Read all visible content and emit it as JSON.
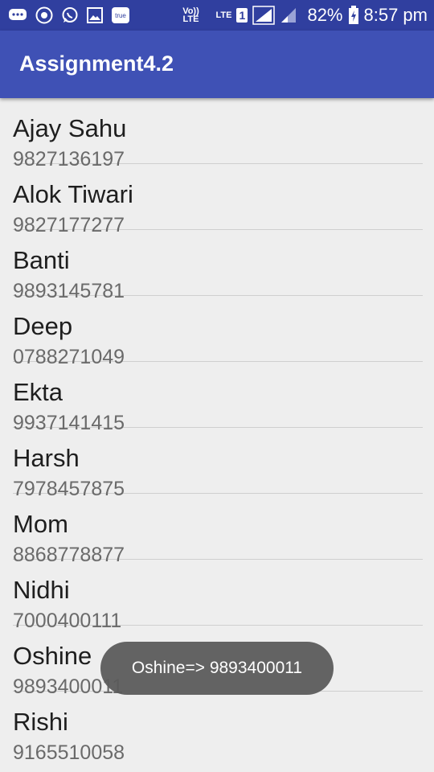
{
  "status_bar": {
    "battery_percent": "82%",
    "time": "8:57 pm",
    "volte_label": "Vo)) LTE",
    "lte_label": "LTE",
    "sim_number": "1",
    "icons": [
      "messages-icon",
      "browser-icon",
      "whatsapp-icon",
      "gallery-icon",
      "truecaller-icon",
      "signal-icon",
      "battery-icon"
    ],
    "truecaller_label": "true"
  },
  "app_bar": {
    "title": "Assignment4.2"
  },
  "contacts": [
    {
      "name": "Ajay Sahu",
      "phone": "9827136197"
    },
    {
      "name": "Alok Tiwari",
      "phone": "9827177277"
    },
    {
      "name": "Banti",
      "phone": "9893145781"
    },
    {
      "name": "Deep",
      "phone": "0788271049"
    },
    {
      "name": "Ekta",
      "phone": "9937141415"
    },
    {
      "name": "Harsh",
      "phone": "7978457875"
    },
    {
      "name": "Mom",
      "phone": "8868778877"
    },
    {
      "name": "Nidhi",
      "phone": "7000400111"
    },
    {
      "name": "Oshine",
      "phone": "9893400011"
    },
    {
      "name": "Rishi",
      "phone": "9165510058"
    }
  ],
  "toast": {
    "text": "Oshine=> 9893400011"
  },
  "colors": {
    "status_bar": "#303f9f",
    "app_bar": "#3f51b5",
    "background": "#eeeeee"
  }
}
